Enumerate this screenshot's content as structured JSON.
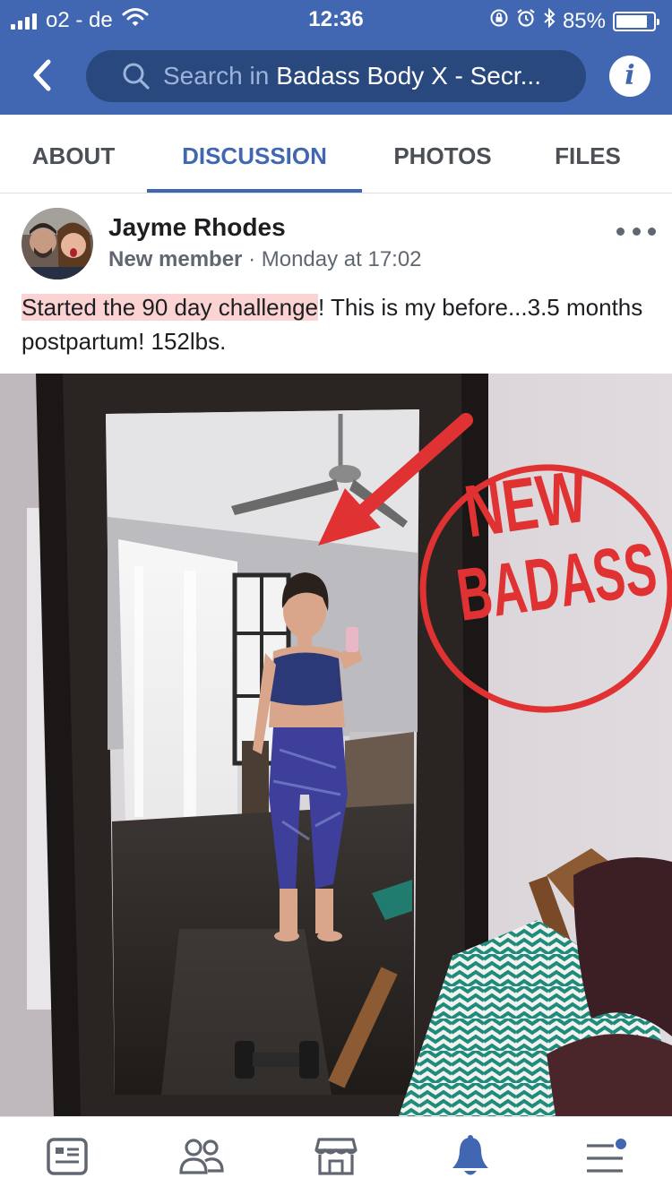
{
  "status_bar": {
    "carrier": "o2 - de",
    "time": "12:36",
    "battery_text": "85%",
    "battery_level": 0.85,
    "icons": [
      "signal-icon",
      "wifi-icon",
      "orientation-lock-icon",
      "alarm-icon",
      "bluetooth-icon",
      "battery-icon"
    ]
  },
  "header": {
    "search_placeholder": "Search in",
    "search_group": "Badass Body X - Secr...",
    "info_label": "i",
    "accent": "#4267b2"
  },
  "tabs": [
    {
      "label": "ABOUT",
      "active": false
    },
    {
      "label": "DISCUSSION",
      "active": true
    },
    {
      "label": "PHOTOS",
      "active": false
    },
    {
      "label": "FILES",
      "active": false
    }
  ],
  "post": {
    "author": "Jayme Rhodes",
    "role": "New member",
    "separator": "·",
    "timestamp": "Monday at 17:02",
    "text_highlighted": "Started the 90 day challenge",
    "text_rest": "! This is my before...3.5 months postpartum! 152lbs."
  },
  "photo": {
    "stamp_line1": "NEW",
    "stamp_line2": "BADASS",
    "stamp_color": "#e03232"
  },
  "bottom_nav": [
    {
      "icon": "news-feed-icon",
      "active": false
    },
    {
      "icon": "groups-icon",
      "active": false
    },
    {
      "icon": "marketplace-icon",
      "active": false
    },
    {
      "icon": "notifications-bell-icon",
      "active": true
    },
    {
      "icon": "menu-icon",
      "active": false
    }
  ]
}
